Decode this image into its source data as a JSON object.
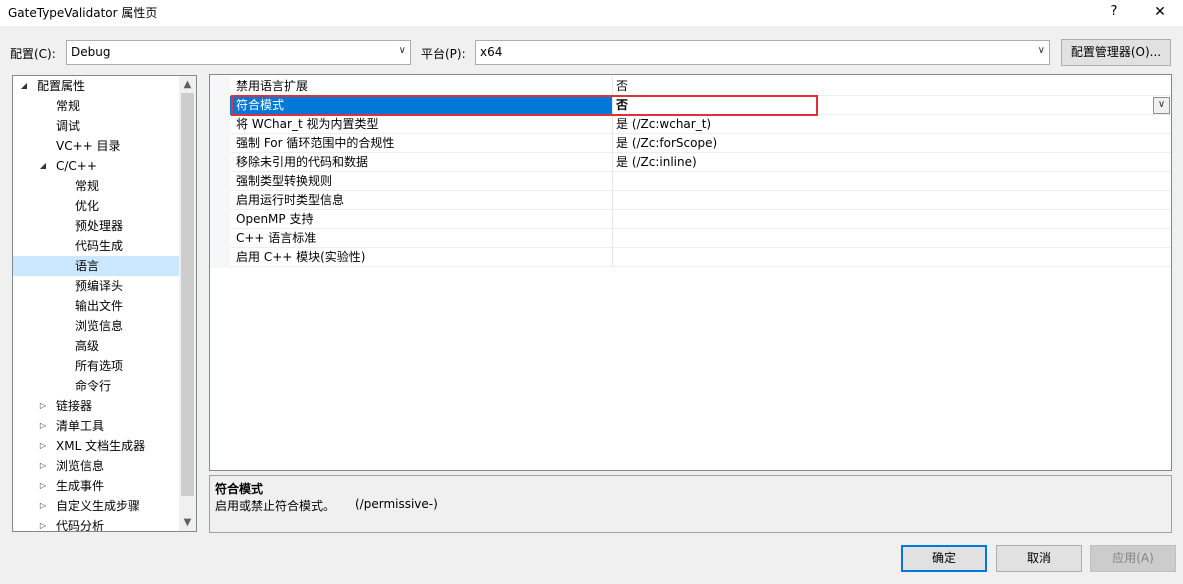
{
  "window": {
    "title": "GateTypeValidator 属性页",
    "help": "?",
    "close": "✕"
  },
  "toolbar": {
    "config_label": "配置(C):",
    "config_value": "Debug",
    "platform_label": "平台(P):",
    "platform_value": "x64",
    "config_manager": "配置管理器(O)..."
  },
  "tree": [
    {
      "label": "配置属性",
      "expander": "◢"
    },
    {
      "label": "常规",
      "expander": ""
    },
    {
      "label": "调试",
      "expander": ""
    },
    {
      "label": "VC++ 目录",
      "expander": ""
    },
    {
      "label": "C/C++",
      "expander": "◢"
    },
    {
      "label": "常规",
      "expander": ""
    },
    {
      "label": "优化",
      "expander": ""
    },
    {
      "label": "预处理器",
      "expander": ""
    },
    {
      "label": "代码生成",
      "expander": ""
    },
    {
      "label": "语言",
      "expander": "",
      "selected": true
    },
    {
      "label": "预编译头",
      "expander": ""
    },
    {
      "label": "输出文件",
      "expander": ""
    },
    {
      "label": "浏览信息",
      "expander": ""
    },
    {
      "label": "高级",
      "expander": ""
    },
    {
      "label": "所有选项",
      "expander": ""
    },
    {
      "label": "命令行",
      "expander": ""
    },
    {
      "label": "链接器",
      "expander": "▷"
    },
    {
      "label": "清单工具",
      "expander": "▷"
    },
    {
      "label": "XML 文档生成器",
      "expander": "▷"
    },
    {
      "label": "浏览信息",
      "expander": "▷"
    },
    {
      "label": "生成事件",
      "expander": "▷"
    },
    {
      "label": "自定义生成步骤",
      "expander": "▷"
    },
    {
      "label": "代码分析",
      "expander": "▷"
    }
  ],
  "scroll": {
    "up": "▲",
    "down": "▼"
  },
  "properties": [
    {
      "name": "禁用语言扩展",
      "value": "否"
    },
    {
      "name": "符合模式",
      "value": "否",
      "selected": true
    },
    {
      "name": "将 WChar_t 视为内置类型",
      "value": "是 (/Zc:wchar_t)"
    },
    {
      "name": "强制 For 循环范围中的合规性",
      "value": "是 (/Zc:forScope)"
    },
    {
      "name": "移除未引用的代码和数据",
      "value": "是 (/Zc:inline)"
    },
    {
      "name": "强制类型转换规则",
      "value": ""
    },
    {
      "name": "启用运行时类型信息",
      "value": ""
    },
    {
      "name": "OpenMP 支持",
      "value": ""
    },
    {
      "name": "C++ 语言标准",
      "value": ""
    },
    {
      "name": "启用 C++ 模块(实验性)",
      "value": ""
    }
  ],
  "description": {
    "title": "符合模式",
    "text": "启用或禁止符合模式。",
    "flag": "(/permissive-)"
  },
  "buttons": {
    "ok": "确定",
    "cancel": "取消",
    "apply": "应用(A)"
  },
  "colors": {
    "selection": "#0078d7",
    "tree_selection": "#cce8ff",
    "highlight_box": "#e0303a"
  }
}
